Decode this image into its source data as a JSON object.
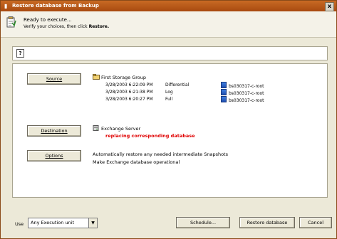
{
  "window": {
    "title": "Restore database from Backup",
    "close_glyph": "x"
  },
  "header": {
    "line1": "Ready to execute...",
    "line2_prefix": "Verify your choices, then click ",
    "line2_bold": "Restore."
  },
  "help": {
    "icon": "?"
  },
  "sections": {
    "source": {
      "button": "Source",
      "group": "First Storage Group",
      "rows": [
        {
          "time": "3/28/2003 6:22:09 PM",
          "type": "Differential",
          "target": "bs030317-c-root"
        },
        {
          "time": "3/28/2003 6:21:38 PM",
          "type": "Log",
          "target": "bs030317-c-root"
        },
        {
          "time": "3/28/2003 6:20:27 PM",
          "type": "Full",
          "target": "bs030317-c-root"
        }
      ]
    },
    "destination": {
      "button": "Destination",
      "server": "Exchange Server",
      "note": "replacing corresponding database"
    },
    "options": {
      "button": "Options",
      "lines": [
        "Automatically restore any needed intermediate Snapshots",
        "Make Exchange database operational"
      ]
    }
  },
  "footer": {
    "use_label": "Use",
    "unit_value": "Any Execution unit",
    "schedule": "Schedule...",
    "restore": "Restore database",
    "cancel": "Cancel"
  }
}
